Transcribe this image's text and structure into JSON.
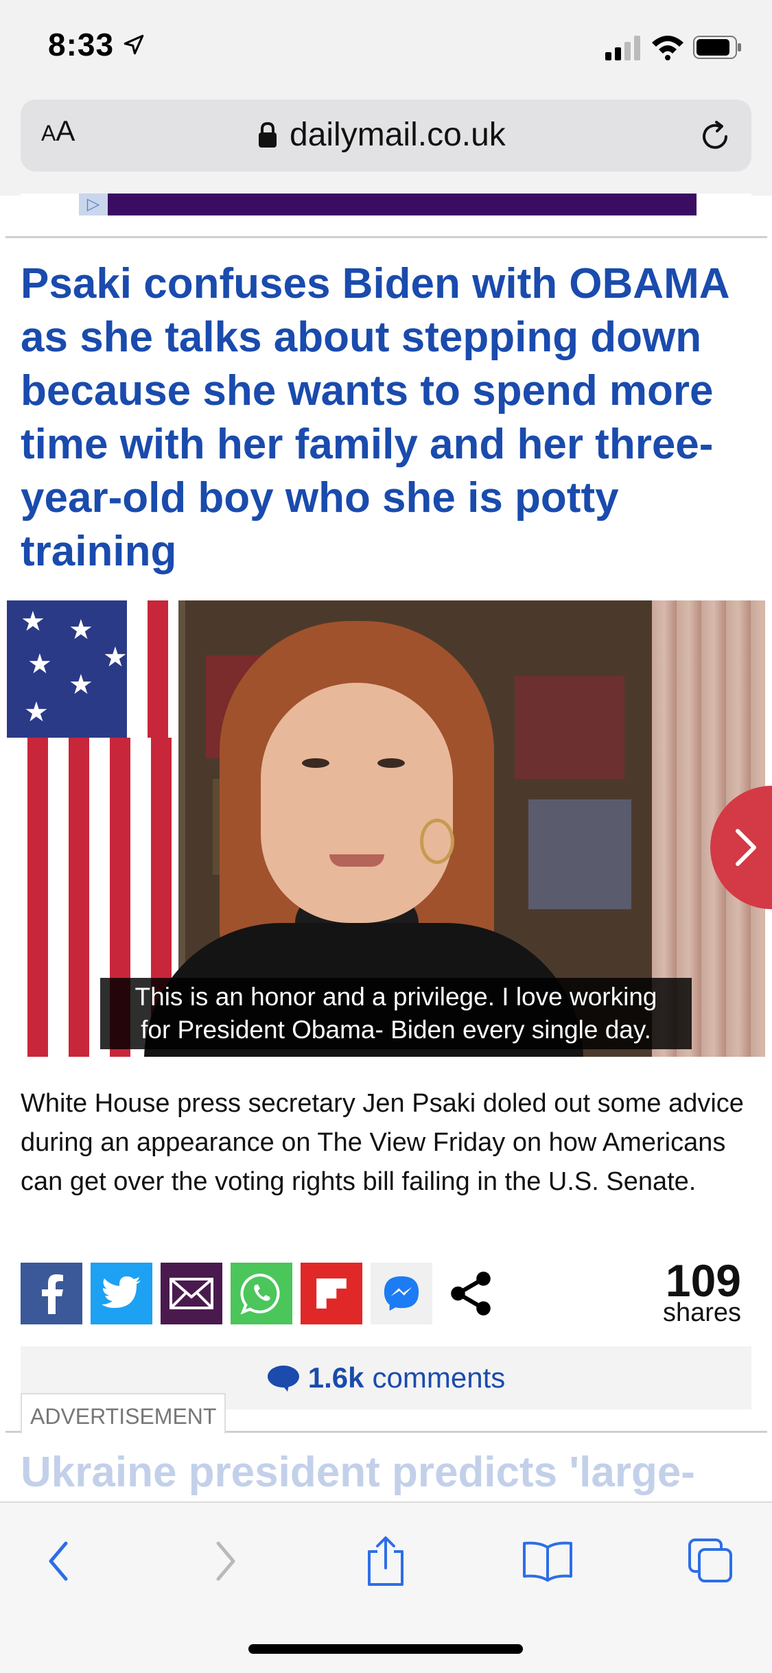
{
  "status": {
    "time": "8:33"
  },
  "browser": {
    "aa_small": "A",
    "aa_large": "A",
    "url": "dailymail.co.uk"
  },
  "article": {
    "headline": "Psaki confuses Biden with OBAMA as she talks about stepping down because she wants to spend more time with her family and her three-year-old boy who she is potty training",
    "video_caption_line1": "This is an honor and a privilege. I love working",
    "video_caption_line2": "for President Obama- Biden every single day.",
    "summary": "White House press secretary Jen Psaki doled out some advice during an appearance on The View Friday on how Americans can get over the voting rights bill failing in the U.S. Senate.",
    "shares_count": "109",
    "shares_label": "shares",
    "comments_count": "1.6k",
    "comments_label": "comments",
    "advertisement_label": "ADVERTISEMENT",
    "next_headline": "Ukraine president predicts 'large-"
  },
  "share_buttons": [
    {
      "icon": "facebook-icon",
      "color": "#3b5998"
    },
    {
      "icon": "twitter-icon",
      "color": "#1da1f2"
    },
    {
      "icon": "email-icon",
      "color": "#4a1a4e"
    },
    {
      "icon": "whatsapp-icon",
      "color": "#4bc65b"
    },
    {
      "icon": "flipboard-icon",
      "color": "#e12828"
    },
    {
      "icon": "messenger-icon",
      "color": "#1c7cf4"
    },
    {
      "icon": "share-icon",
      "color": "#000000"
    }
  ],
  "colors": {
    "headline_blue": "#1a4bad",
    "next_arrow_red": "#d33a45"
  }
}
